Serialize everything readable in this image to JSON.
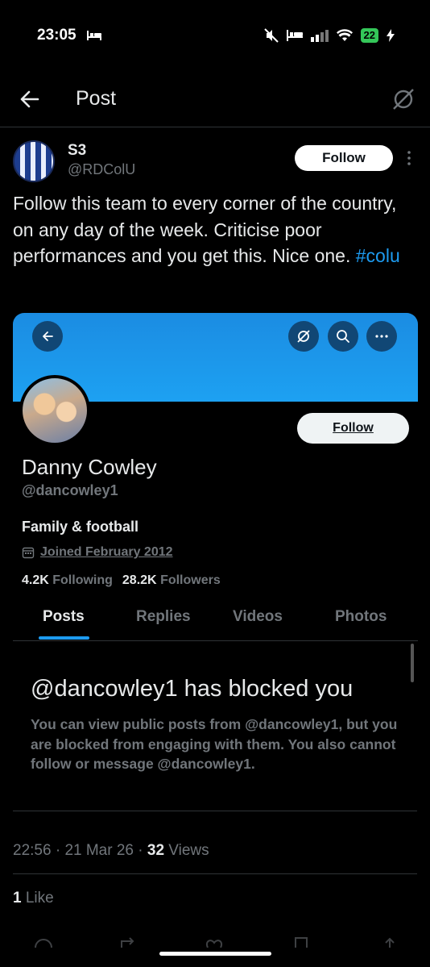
{
  "status_bar": {
    "time": "23:05",
    "battery": "22"
  },
  "header": {
    "title": "Post"
  },
  "post": {
    "author_name": "S3",
    "author_handle": "@RDColU",
    "follow_label": "Follow",
    "text": "Follow this team to every corner of the country, on any day of the week. Criticise poor performances and you get this. Nice one. ",
    "hashtag": "#colu",
    "time": "22:56",
    "date": "21 Mar 26",
    "views_count": "32",
    "views_label": "Views",
    "likes_count": "1",
    "likes_label": "Like"
  },
  "embed": {
    "follow_label": "Follow",
    "display_name": "Danny Cowley",
    "handle": "@dancowley1",
    "bio": "Family & football",
    "joined": "Joined February 2012",
    "following_count": "4.2K",
    "following_label": "Following",
    "followers_count": "28.2K",
    "followers_label": "Followers",
    "tabs": [
      "Posts",
      "Replies",
      "Videos",
      "Photos"
    ],
    "blocked_title": "@dancowley1 has blocked you",
    "blocked_body": "You can view public posts from @dancowley1, but you are blocked from engaging with them. You also cannot follow or message @dancowley1."
  },
  "colors": {
    "accent": "#1d9bf0",
    "background": "#000000",
    "muted": "#71767b",
    "banner": "#1da1f2"
  }
}
